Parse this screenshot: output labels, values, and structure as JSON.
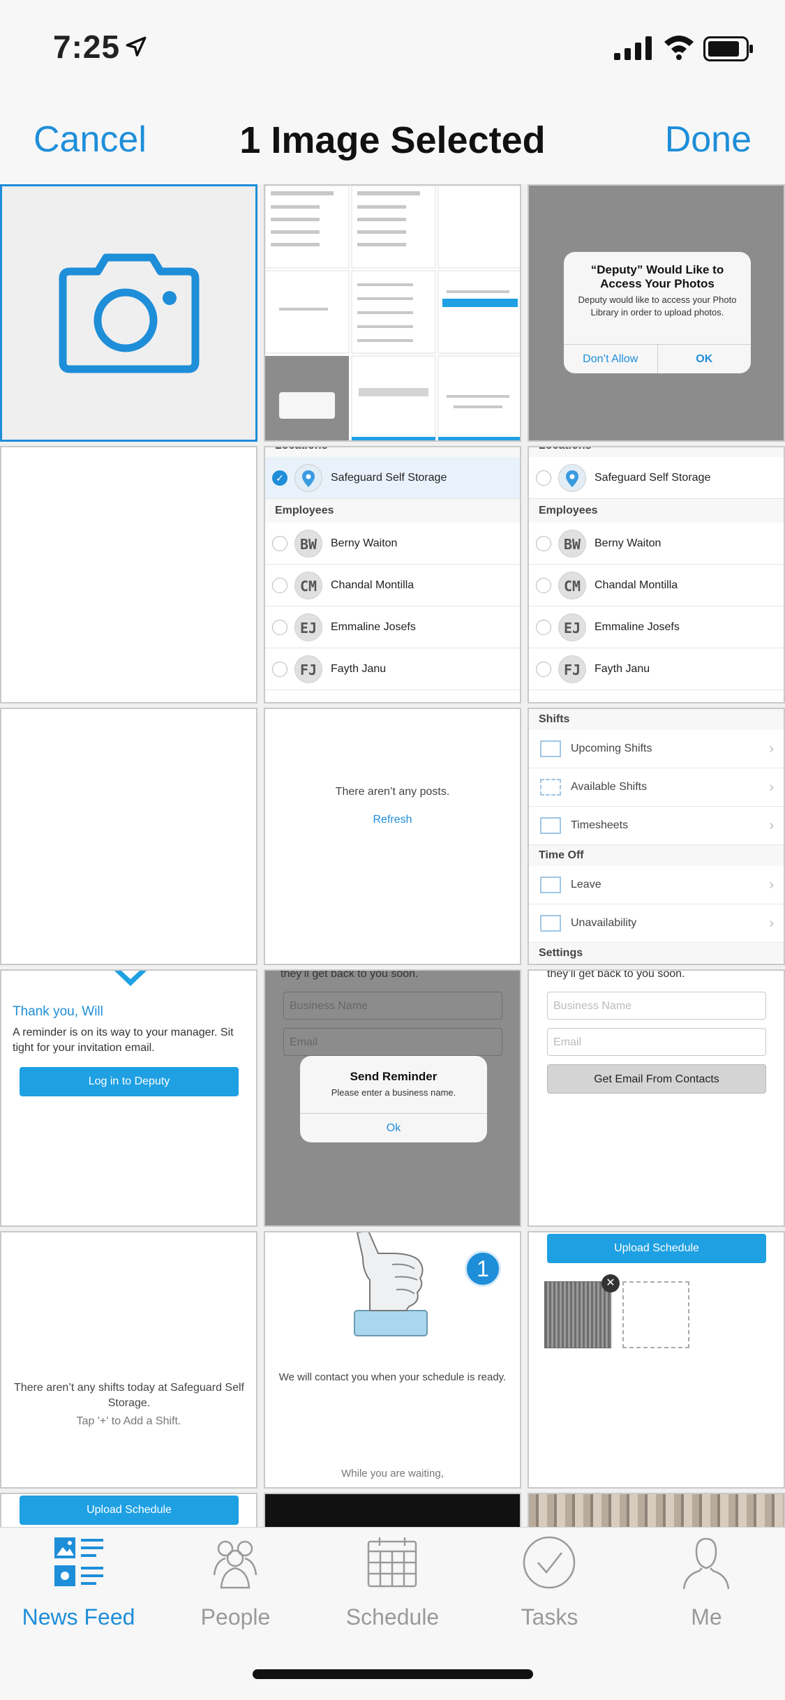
{
  "status": {
    "time": "7:25"
  },
  "nav": {
    "cancel": "Cancel",
    "title": "1 Image Selected",
    "done": "Done"
  },
  "thumb_permission": {
    "title": "“Deputy” Would Like to Access Your Photos",
    "message": "Deputy would like to access your Photo Library in order to upload photos.",
    "dont_allow": "Don’t Allow",
    "ok": "OK"
  },
  "thumb_locations_a": {
    "header_locations": "Locations",
    "location": "Safeguard Self Storage",
    "header_employees": "Employees",
    "employees": [
      {
        "initials": "BW",
        "name": "Berny Waiton"
      },
      {
        "initials": "CM",
        "name": "Chandal Montilla"
      },
      {
        "initials": "EJ",
        "name": "Emmaline Josefs"
      },
      {
        "initials": "FJ",
        "name": "Fayth Janu"
      }
    ]
  },
  "thumb_posts": {
    "empty": "There aren’t any posts.",
    "refresh": "Refresh"
  },
  "thumb_menu": {
    "shifts_header": "Shifts",
    "items_shifts": [
      "Upcoming Shifts",
      "Available Shifts",
      "Timesheets"
    ],
    "timeoff_header": "Time Off",
    "items_timeoff": [
      "Leave",
      "Unavailability"
    ],
    "settings_header": "Settings"
  },
  "thumb_thanks": {
    "title": "Thank you, Will",
    "message": "A reminder is on its way to your manager. Sit tight for your invitation email.",
    "button": "Log in to Deputy"
  },
  "thumb_reminder": {
    "top_text": "they’ll get back to you soon.",
    "business_placeholder": "Business Name",
    "email_placeholder": "Email",
    "dialog_title": "Send Reminder",
    "dialog_message": "Please enter a business name.",
    "dialog_ok": "Ok"
  },
  "thumb_form": {
    "top_text": "they’ll get back to you soon.",
    "business_placeholder": "Business Name",
    "email_placeholder": "Email",
    "contacts_button": "Get Email From Contacts"
  },
  "thumb_noshifts": {
    "message": "There aren’t any shifts today at Safeguard Self Storage.",
    "hint": "Tap '+' to Add a Shift."
  },
  "thumb_contact": {
    "badge": "1",
    "message": "We will contact you when your schedule is ready.",
    "waiting": "While you are waiting,"
  },
  "thumb_upload": {
    "button": "Upload Schedule"
  },
  "thumb_upload_small": {
    "button": "Upload Schedule"
  },
  "tabs": [
    {
      "label": "News Feed",
      "icon": "news-feed-icon",
      "active": true
    },
    {
      "label": "People",
      "icon": "people-icon"
    },
    {
      "label": "Schedule",
      "icon": "calendar-icon"
    },
    {
      "label": "Tasks",
      "icon": "check-circle-icon"
    },
    {
      "label": "Me",
      "icon": "person-icon"
    }
  ],
  "colors": {
    "accent": "#1e8ed9",
    "button_blue": "#1ea0e3"
  }
}
